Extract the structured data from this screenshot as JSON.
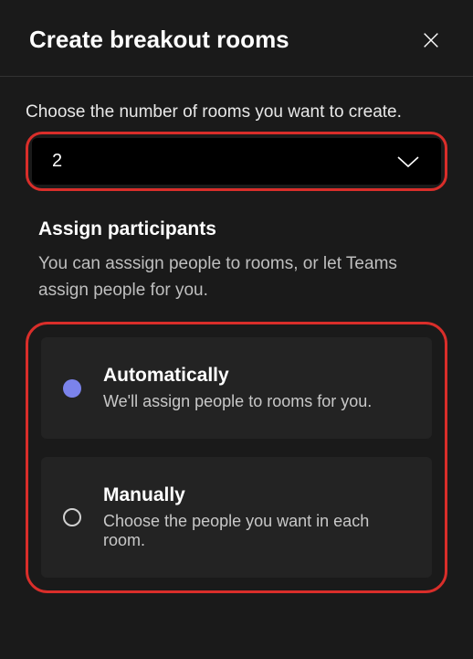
{
  "header": {
    "title": "Create breakout rooms"
  },
  "prompt": "Choose the number of rooms you want to create.",
  "dropdown": {
    "value": "2"
  },
  "assign": {
    "title": "Assign participants",
    "desc": "You can asssign people to rooms, or let Teams assign people for you."
  },
  "options": {
    "auto": {
      "title": "Automatically",
      "desc": "We'll assign people to rooms for you."
    },
    "manual": {
      "title": "Manually",
      "desc": "Choose the people you want in each room."
    }
  }
}
